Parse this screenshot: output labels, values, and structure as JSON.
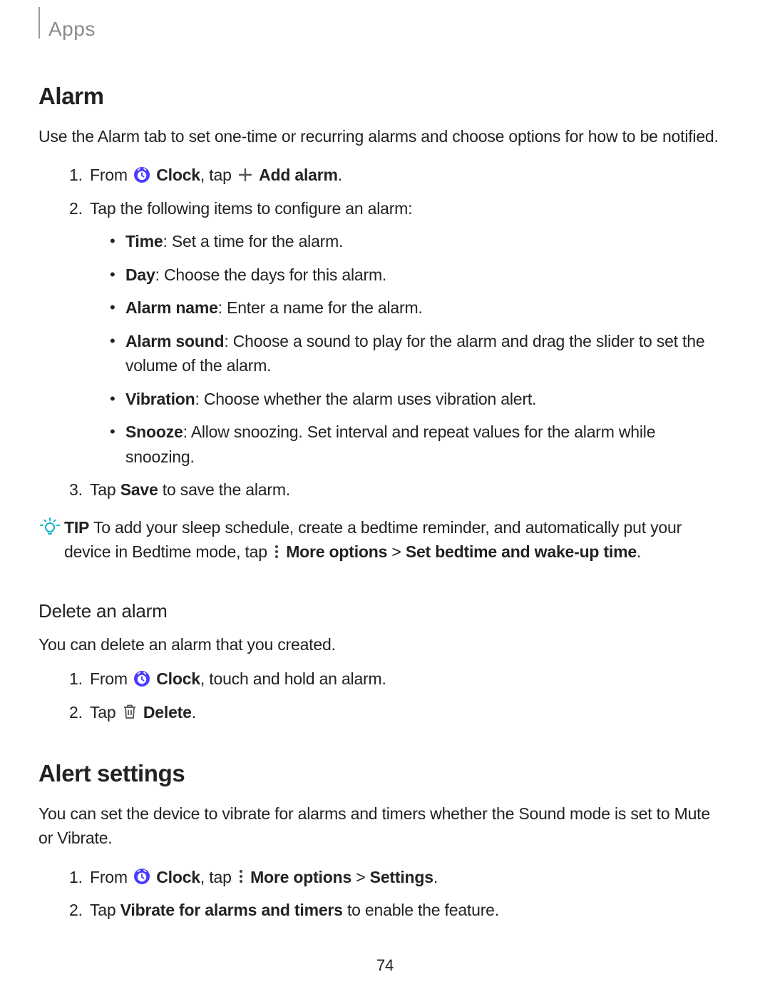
{
  "header": {
    "breadcrumb": "Apps"
  },
  "section_alarm": {
    "title": "Alarm",
    "intro": "Use the Alarm tab to set one-time or recurring alarms and choose options for how to be notified.",
    "step1": {
      "from": "From ",
      "clock_label": "Clock",
      "tap": ", tap ",
      "add_alarm_label": "Add alarm",
      "period": "."
    },
    "step2": {
      "lead": "Tap the following items to configure an alarm:",
      "items": [
        {
          "term": "Time",
          "desc": ": Set a time for the alarm."
        },
        {
          "term": "Day",
          "desc": ": Choose the days for this alarm."
        },
        {
          "term": "Alarm name",
          "desc": ": Enter a name for the alarm."
        },
        {
          "term": "Alarm sound",
          "desc": ": Choose a sound to play for the alarm and drag the slider to set the volume of the alarm."
        },
        {
          "term": "Vibration",
          "desc": ": Choose whether the alarm uses vibration alert."
        },
        {
          "term": "Snooze",
          "desc": ": Allow snoozing. Set interval and repeat values for the alarm while snoozing."
        }
      ]
    },
    "step3": {
      "pre": "Tap ",
      "save": "Save",
      "post": " to save the alarm."
    },
    "tip": {
      "label": "TIP",
      "pre": "  To add your sleep schedule, create a bedtime reminder, and automatically put your device in Bedtime mode, tap ",
      "more_options": "More options",
      "sep": " > ",
      "bedtime": "Set bedtime and wake-up time",
      "period": "."
    }
  },
  "section_delete": {
    "title": "Delete an alarm",
    "intro": "You can delete an alarm that you created.",
    "step1": {
      "from": "From ",
      "clock_label": "Clock",
      "post": ", touch and hold an alarm."
    },
    "step2": {
      "pre": "Tap ",
      "delete_label": "Delete",
      "period": "."
    }
  },
  "section_alert": {
    "title": "Alert settings",
    "intro": "You can set the device to vibrate for alarms and timers whether the Sound mode is set to Mute or Vibrate.",
    "step1": {
      "from": "From ",
      "clock_label": "Clock",
      "tap": ", tap ",
      "more_options": "More options",
      "sep": " > ",
      "settings": "Settings",
      "period": "."
    },
    "step2": {
      "pre": "Tap ",
      "vibrate_label": "Vibrate for alarms and timers",
      "post": " to enable the feature."
    }
  },
  "page_number": "74"
}
